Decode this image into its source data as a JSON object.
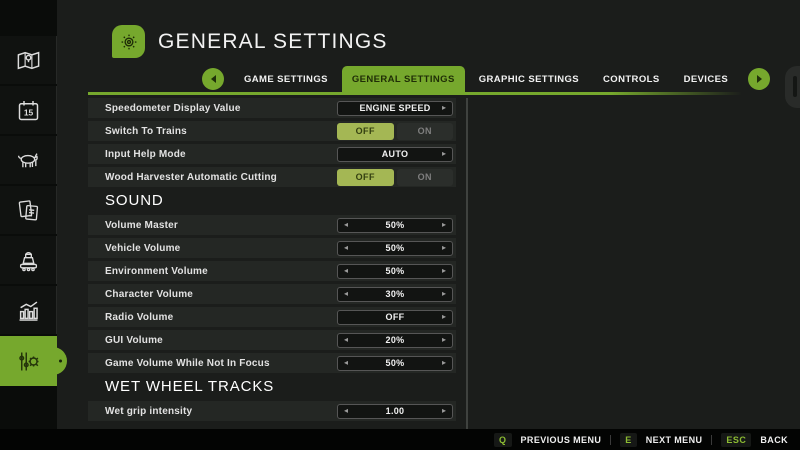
{
  "header": {
    "title": "GENERAL SETTINGS",
    "icon": "gear-icon"
  },
  "tabs": {
    "prev_icon": "arrow-left-icon",
    "next_icon": "arrow-right-icon",
    "items": [
      {
        "label": "GAME SETTINGS",
        "active": false
      },
      {
        "label": "GENERAL SETTINGS",
        "active": true
      },
      {
        "label": "GRAPHIC SETTINGS",
        "active": false
      },
      {
        "label": "CONTROLS",
        "active": false
      },
      {
        "label": "DEVICES",
        "active": false
      }
    ]
  },
  "sidebar": {
    "items": [
      {
        "name": "map",
        "icon": "map-icon",
        "active": false
      },
      {
        "name": "calendar",
        "icon": "calendar-icon",
        "active": false
      },
      {
        "name": "animals",
        "icon": "animals-icon",
        "active": false
      },
      {
        "name": "finances",
        "icon": "finances-icon",
        "active": false
      },
      {
        "name": "production",
        "icon": "production-icon",
        "active": false
      },
      {
        "name": "statistics",
        "icon": "statistics-icon",
        "active": false
      },
      {
        "name": "settings",
        "icon": "settings-icon",
        "active": true
      }
    ]
  },
  "settings": {
    "sections": [
      {
        "heading": "",
        "rows": [
          {
            "label": "Speedometer Display Value",
            "control": {
              "type": "selector",
              "value": "ENGINE SPEED",
              "left_arrow": false,
              "right_arrow": true
            }
          },
          {
            "label": "Switch To Trains",
            "control": {
              "type": "toggle",
              "options": [
                "OFF",
                "ON"
              ],
              "selected": "OFF"
            }
          },
          {
            "label": "Input Help Mode",
            "control": {
              "type": "selector",
              "value": "AUTO",
              "left_arrow": false,
              "right_arrow": true
            }
          },
          {
            "label": "Wood Harvester Automatic Cutting",
            "control": {
              "type": "toggle",
              "options": [
                "OFF",
                "ON"
              ],
              "selected": "OFF"
            }
          }
        ]
      },
      {
        "heading": "SOUND",
        "rows": [
          {
            "label": "Volume Master",
            "control": {
              "type": "selector",
              "value": "50%",
              "left_arrow": true,
              "right_arrow": true
            }
          },
          {
            "label": "Vehicle Volume",
            "control": {
              "type": "selector",
              "value": "50%",
              "left_arrow": true,
              "right_arrow": true
            }
          },
          {
            "label": "Environment Volume",
            "control": {
              "type": "selector",
              "value": "50%",
              "left_arrow": true,
              "right_arrow": true
            }
          },
          {
            "label": "Character Volume",
            "control": {
              "type": "selector",
              "value": "30%",
              "left_arrow": true,
              "right_arrow": true
            }
          },
          {
            "label": "Radio Volume",
            "control": {
              "type": "selector",
              "value": "OFF",
              "left_arrow": false,
              "right_arrow": true
            }
          },
          {
            "label": "GUI Volume",
            "control": {
              "type": "selector",
              "value": "20%",
              "left_arrow": true,
              "right_arrow": true
            }
          },
          {
            "label": "Game Volume While Not In Focus",
            "control": {
              "type": "selector",
              "value": "50%",
              "left_arrow": true,
              "right_arrow": true
            }
          }
        ]
      },
      {
        "heading": "WET WHEEL TRACKS",
        "rows": [
          {
            "label": "Wet grip intensity",
            "control": {
              "type": "selector",
              "value": "1.00",
              "left_arrow": true,
              "right_arrow": true
            }
          }
        ]
      }
    ]
  },
  "footer": {
    "hints": [
      {
        "key": "Q",
        "label": "PREVIOUS MENU"
      },
      {
        "key": "E",
        "label": "NEXT MENU"
      },
      {
        "key": "ESC",
        "label": "BACK"
      }
    ]
  },
  "colors": {
    "accent": "#76a82d",
    "toggle_active": "#a4b754",
    "key_hint": "#8cbc32",
    "underline": "#76a82d"
  }
}
